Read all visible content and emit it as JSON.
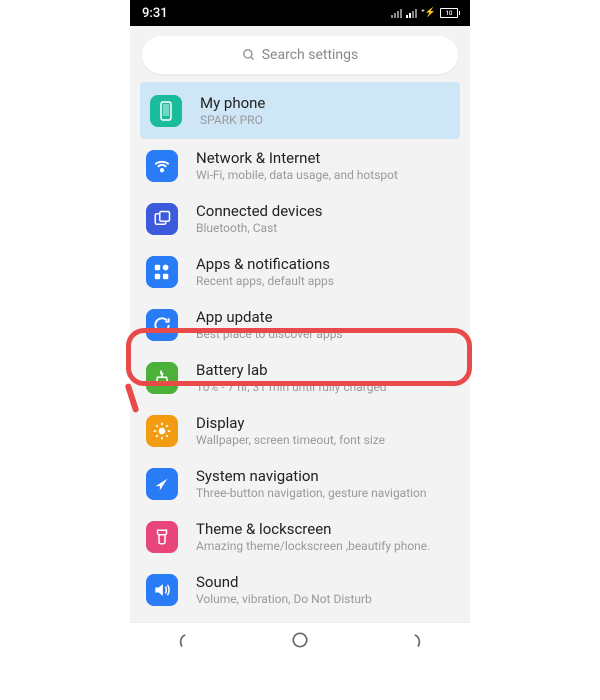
{
  "status": {
    "time": "9:31",
    "battery_text": "10"
  },
  "search": {
    "placeholder": "Search settings"
  },
  "items": [
    {
      "title": "My phone",
      "sub": "SPARK PRO",
      "icon": "phone-icon",
      "color": "#1abc9c",
      "highlighted": true
    },
    {
      "title": "Network & Internet",
      "sub": "Wi-Fi, mobile, data usage, and hotspot",
      "icon": "wifi-icon",
      "color": "#2a7cf6"
    },
    {
      "title": "Connected devices",
      "sub": "Bluetooth, Cast",
      "icon": "connected-icon",
      "color": "#3b5bdb"
    },
    {
      "title": "Apps & notifications",
      "sub": "Recent apps, default apps",
      "icon": "apps-icon",
      "color": "#2a7cf6"
    },
    {
      "title": "App update",
      "sub": "Best place to discover apps",
      "icon": "update-icon",
      "color": "#2a7cf6"
    },
    {
      "title": "Battery lab",
      "sub": "10% - 7 hr, 31 min until fully charged",
      "icon": "battery-icon",
      "color": "#4cb138"
    },
    {
      "title": "Display",
      "sub": "Wallpaper, screen timeout, font size",
      "icon": "display-icon",
      "color": "#f39c12"
    },
    {
      "title": "System navigation",
      "sub": "Three-button navigation, gesture navigation",
      "icon": "navigation-icon",
      "color": "#2a7cf6"
    },
    {
      "title": "Theme & lockscreen",
      "sub": "Amazing theme/lockscreen ,beautify phone.",
      "icon": "theme-icon",
      "color": "#e8467a"
    },
    {
      "title": "Sound",
      "sub": "Volume, vibration, Do Not Disturb",
      "icon": "sound-icon",
      "color": "#2a7cf6"
    }
  ]
}
